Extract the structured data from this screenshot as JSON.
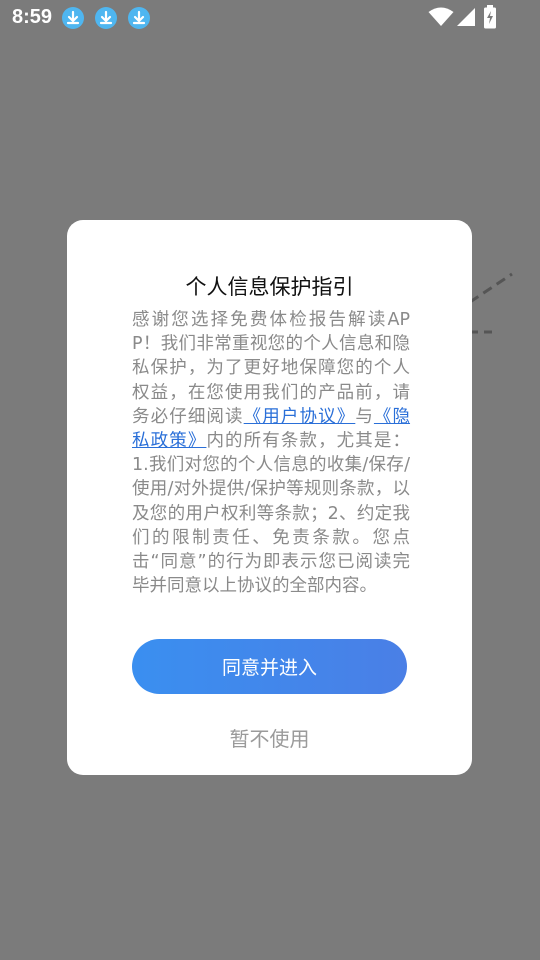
{
  "status_bar": {
    "time": "8:59",
    "notification_icons": [
      "download-icon",
      "download-icon",
      "download-icon"
    ],
    "system_icons": [
      "wifi-icon",
      "signal-icon",
      "battery-charging-icon"
    ]
  },
  "dialog": {
    "title": "个人信息保护指引",
    "body_intro": "感谢您选择免费体检报告解读APP！我们非常重视您的个人信息和隐私保护，为了更好地保障您的个人权益，在您使用我们的产品前，请务必仔细阅读",
    "user_agreement_link": "《用户协议》",
    "connector": "与",
    "privacy_policy_link": "《隐私政策》",
    "body_rest": "内的所有条款，尤其是：1.我们对您的个人信息的收集/保存/使用/对外提供/保护等规则条款，以及您的用户权利等条款；2、约定我们的限制责任、免责条款。您点击“同意”的行为即表示您已阅读完毕并同意以上协议的全部内容。",
    "agree_button": "同意并进入",
    "decline_button": "暂不使用"
  },
  "colors": {
    "overlay": "#7b7b7b",
    "link": "#2a6fd8",
    "primary_button": "#3a8ff0",
    "download_badge": "#4fb6f0"
  }
}
